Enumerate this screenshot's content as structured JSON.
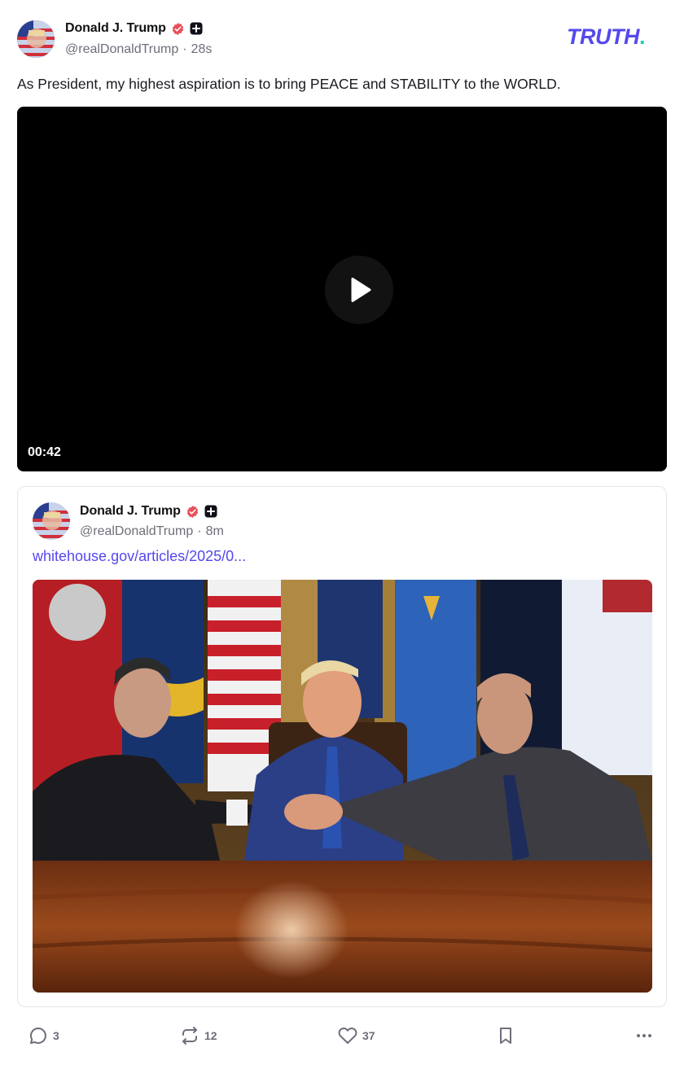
{
  "post": {
    "author": {
      "display_name": "Donald J. Trump",
      "handle": "@realDonaldTrump",
      "time": "28s"
    },
    "brand": {
      "name": "TRUTH",
      "dot": "."
    },
    "text": "As President, my highest aspiration is to bring PEACE and STABILITY to the WORLD.",
    "video": {
      "duration": "00:42"
    },
    "quote": {
      "author": {
        "display_name": "Donald J. Trump",
        "handle": "@realDonaldTrump",
        "time": "8m"
      },
      "link_text": "whitehouse.gov/articles/2025/0..."
    },
    "actions": {
      "replies": "3",
      "reposts": "12",
      "likes": "37"
    }
  },
  "colors": {
    "brand_purple": "#5448ee",
    "brand_teal": "#17d3b5",
    "verified_red": "#e8505b",
    "muted_text": "#6e6e7a"
  },
  "icons": [
    "verified-badge-icon",
    "plus-badge-icon",
    "play-icon",
    "reply-icon",
    "repost-icon",
    "heart-icon",
    "bookmark-icon",
    "more-icon"
  ]
}
